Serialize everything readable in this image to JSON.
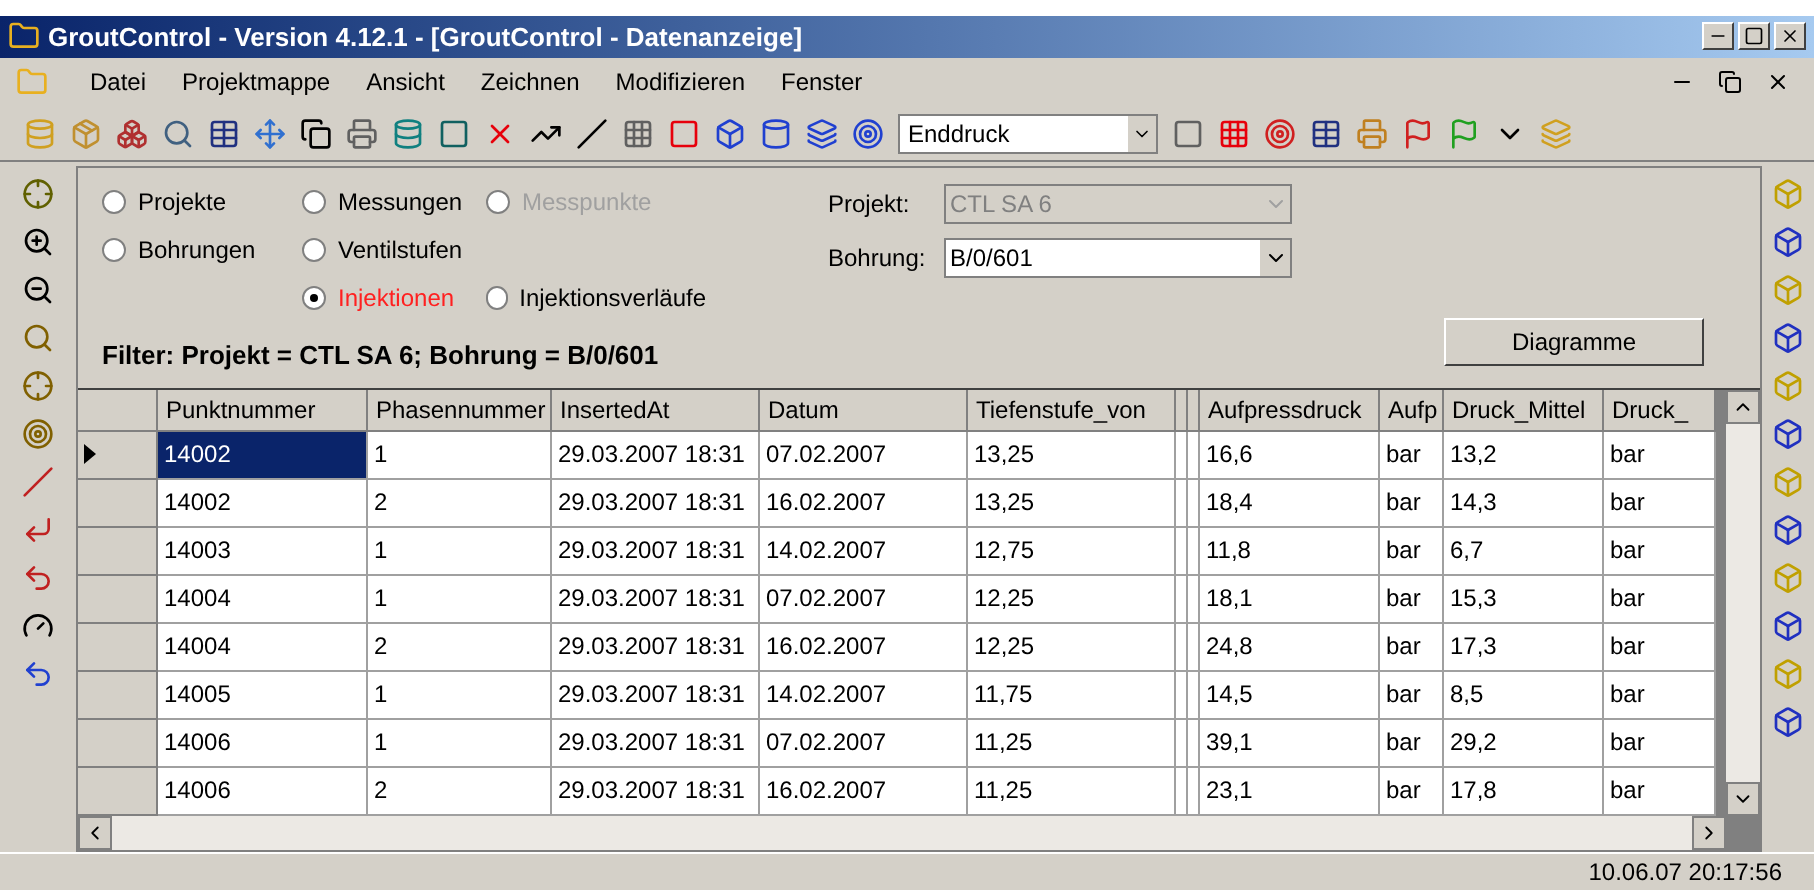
{
  "window": {
    "title": "GroutControl - Version 4.12.1 - [GroutControl - Datenanzeige]"
  },
  "menu": [
    "Datei",
    "Projektmappe",
    "Ansicht",
    "Zeichnen",
    "Modifizieren",
    "Fenster"
  ],
  "toolbar": {
    "combo_value": "Enddruck"
  },
  "radios": [
    {
      "label": "Projekte",
      "selected": false,
      "disabled": false
    },
    {
      "label": "Messungen",
      "selected": false,
      "disabled": false
    },
    {
      "label": "Messpunkte",
      "selected": false,
      "disabled": true
    },
    {
      "label": "Bohrungen",
      "selected": false,
      "disabled": false
    },
    {
      "label": "Ventilstufen",
      "selected": false,
      "disabled": false
    },
    {
      "label": "Injektionen",
      "selected": true,
      "disabled": false
    },
    {
      "label": "Injektionsverläufe",
      "selected": false,
      "disabled": false
    }
  ],
  "fields": [
    {
      "label": "Projekt:",
      "value": "CTL SA 6",
      "disabled": true
    },
    {
      "label": "Bohrung:",
      "value": "B/0/601",
      "disabled": false
    }
  ],
  "filter": "Filter: Projekt = CTL SA 6; Bohrung = B/0/601",
  "diagram_button": "Diagramme",
  "table": {
    "columns": [
      "Punktnummer",
      "Phasennummer",
      "InsertedAt",
      "Datum",
      "Tiefenstufe_von",
      "Aufpressdruck",
      "Aufp",
      "Druck_Mittel",
      "Druck_"
    ],
    "rows": [
      {
        "selected": true,
        "cells": [
          "14002",
          "1",
          "29.03.2007 18:31",
          "07.02.2007",
          "13,25",
          "16,6",
          "bar",
          "13,2",
          "bar"
        ]
      },
      {
        "selected": false,
        "cells": [
          "14002",
          "2",
          "29.03.2007 18:31",
          "16.02.2007",
          "13,25",
          "18,4",
          "bar",
          "14,3",
          "bar"
        ]
      },
      {
        "selected": false,
        "cells": [
          "14003",
          "1",
          "29.03.2007 18:31",
          "14.02.2007",
          "12,75",
          "11,8",
          "bar",
          "6,7",
          "bar"
        ]
      },
      {
        "selected": false,
        "cells": [
          "14004",
          "1",
          "29.03.2007 18:31",
          "07.02.2007",
          "12,25",
          "18,1",
          "bar",
          "15,3",
          "bar"
        ]
      },
      {
        "selected": false,
        "cells": [
          "14004",
          "2",
          "29.03.2007 18:31",
          "16.02.2007",
          "12,25",
          "24,8",
          "bar",
          "17,3",
          "bar"
        ]
      },
      {
        "selected": false,
        "cells": [
          "14005",
          "1",
          "29.03.2007 18:31",
          "14.02.2007",
          "11,75",
          "14,5",
          "bar",
          "8,5",
          "bar"
        ]
      },
      {
        "selected": false,
        "cells": [
          "14006",
          "1",
          "29.03.2007 18:31",
          "07.02.2007",
          "11,25",
          "39,1",
          "bar",
          "29,2",
          "bar"
        ]
      },
      {
        "selected": false,
        "cells": [
          "14006",
          "2",
          "29.03.2007 18:31",
          "16.02.2007",
          "11,25",
          "23,1",
          "bar",
          "17,8",
          "bar"
        ]
      }
    ]
  },
  "status_bar": {
    "time": "10.06.07 20:17:56"
  }
}
